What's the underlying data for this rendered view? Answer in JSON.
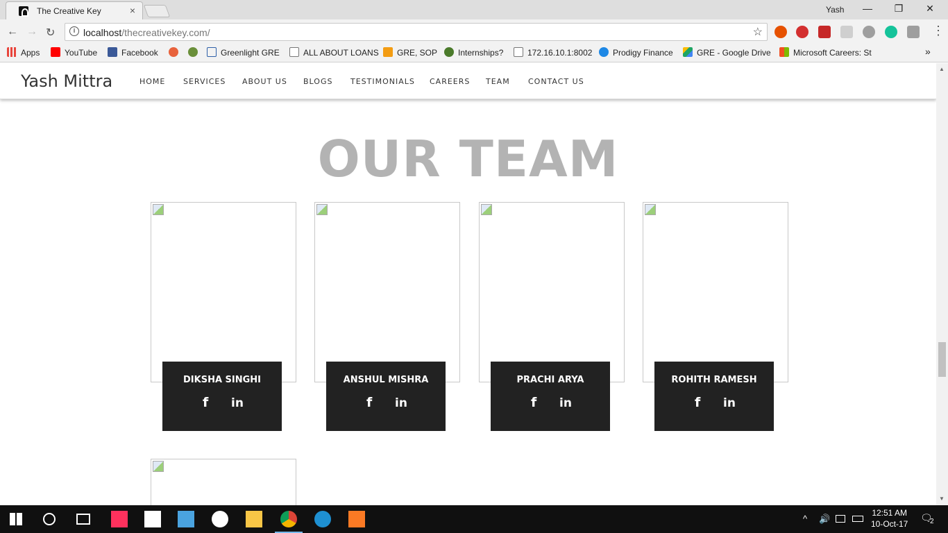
{
  "browser": {
    "tab_title": "The Creative Key",
    "tab_close": "×",
    "profile_name": "Yash",
    "url_host": "localhost",
    "url_path": "/thecreativekey.com/",
    "back": "←",
    "forward": "→",
    "reload": "↻",
    "star": "☆",
    "minimize": "—",
    "restore": "❐",
    "close": "✕",
    "overflow": "»"
  },
  "bookmarks": [
    {
      "label": "Apps",
      "icon": "apps-grid-icon",
      "color": "#e8453c"
    },
    {
      "label": "YouTube",
      "icon": "youtube-icon",
      "color": "#ff0000"
    },
    {
      "label": "Facebook",
      "icon": "facebook-icon",
      "color": "#3b5998"
    },
    {
      "label": "",
      "icon": "owl-icon",
      "color": "#e8623c"
    },
    {
      "label": "",
      "icon": "cat-icon",
      "color": "#6a8f3a"
    },
    {
      "label": "Greenlight GRE",
      "icon": "greenlight-icon",
      "color": "#2d5fa8"
    },
    {
      "label": "ALL ABOUT LOANS",
      "icon": "page-icon",
      "color": "#ffffff"
    },
    {
      "label": "GRE, SOP",
      "icon": "chart-icon",
      "color": "#f39c12"
    },
    {
      "label": "Internships?",
      "icon": "bird-icon",
      "color": "#4a7a2a"
    },
    {
      "label": "172.16.10.1:8002",
      "icon": "page-icon",
      "color": "#ffffff"
    },
    {
      "label": "Prodigy Finance",
      "icon": "prodigy-icon",
      "color": "#1e88e5"
    },
    {
      "label": "GRE - Google Drive",
      "icon": "google-drive-icon",
      "color": "#1fa463"
    },
    {
      "label": "Microsoft Careers: St",
      "icon": "microsoft-icon",
      "color": "#f25022"
    }
  ],
  "site": {
    "brand": "Yash Mittra",
    "menu": [
      "HOME",
      "SERVICES",
      "ABOUT US",
      "BLOGS",
      "TESTIMONIALS",
      "CAREERS",
      "TEAM",
      "CONTACT US"
    ],
    "heading": "OUR TEAM",
    "team": [
      {
        "name": "DIKSHA SINGHI",
        "fb": "f",
        "li": "in"
      },
      {
        "name": "ANSHUL MISHRA",
        "fb": "f",
        "li": "in"
      },
      {
        "name": "PRACHI ARYA",
        "fb": "f",
        "li": "in"
      },
      {
        "name": "ROHITH RAMESH",
        "fb": "f",
        "li": "in"
      }
    ]
  },
  "taskbar": {
    "time": "12:51 AM",
    "date": "10-Oct-17",
    "notifications": "2",
    "tray_up": "^"
  }
}
